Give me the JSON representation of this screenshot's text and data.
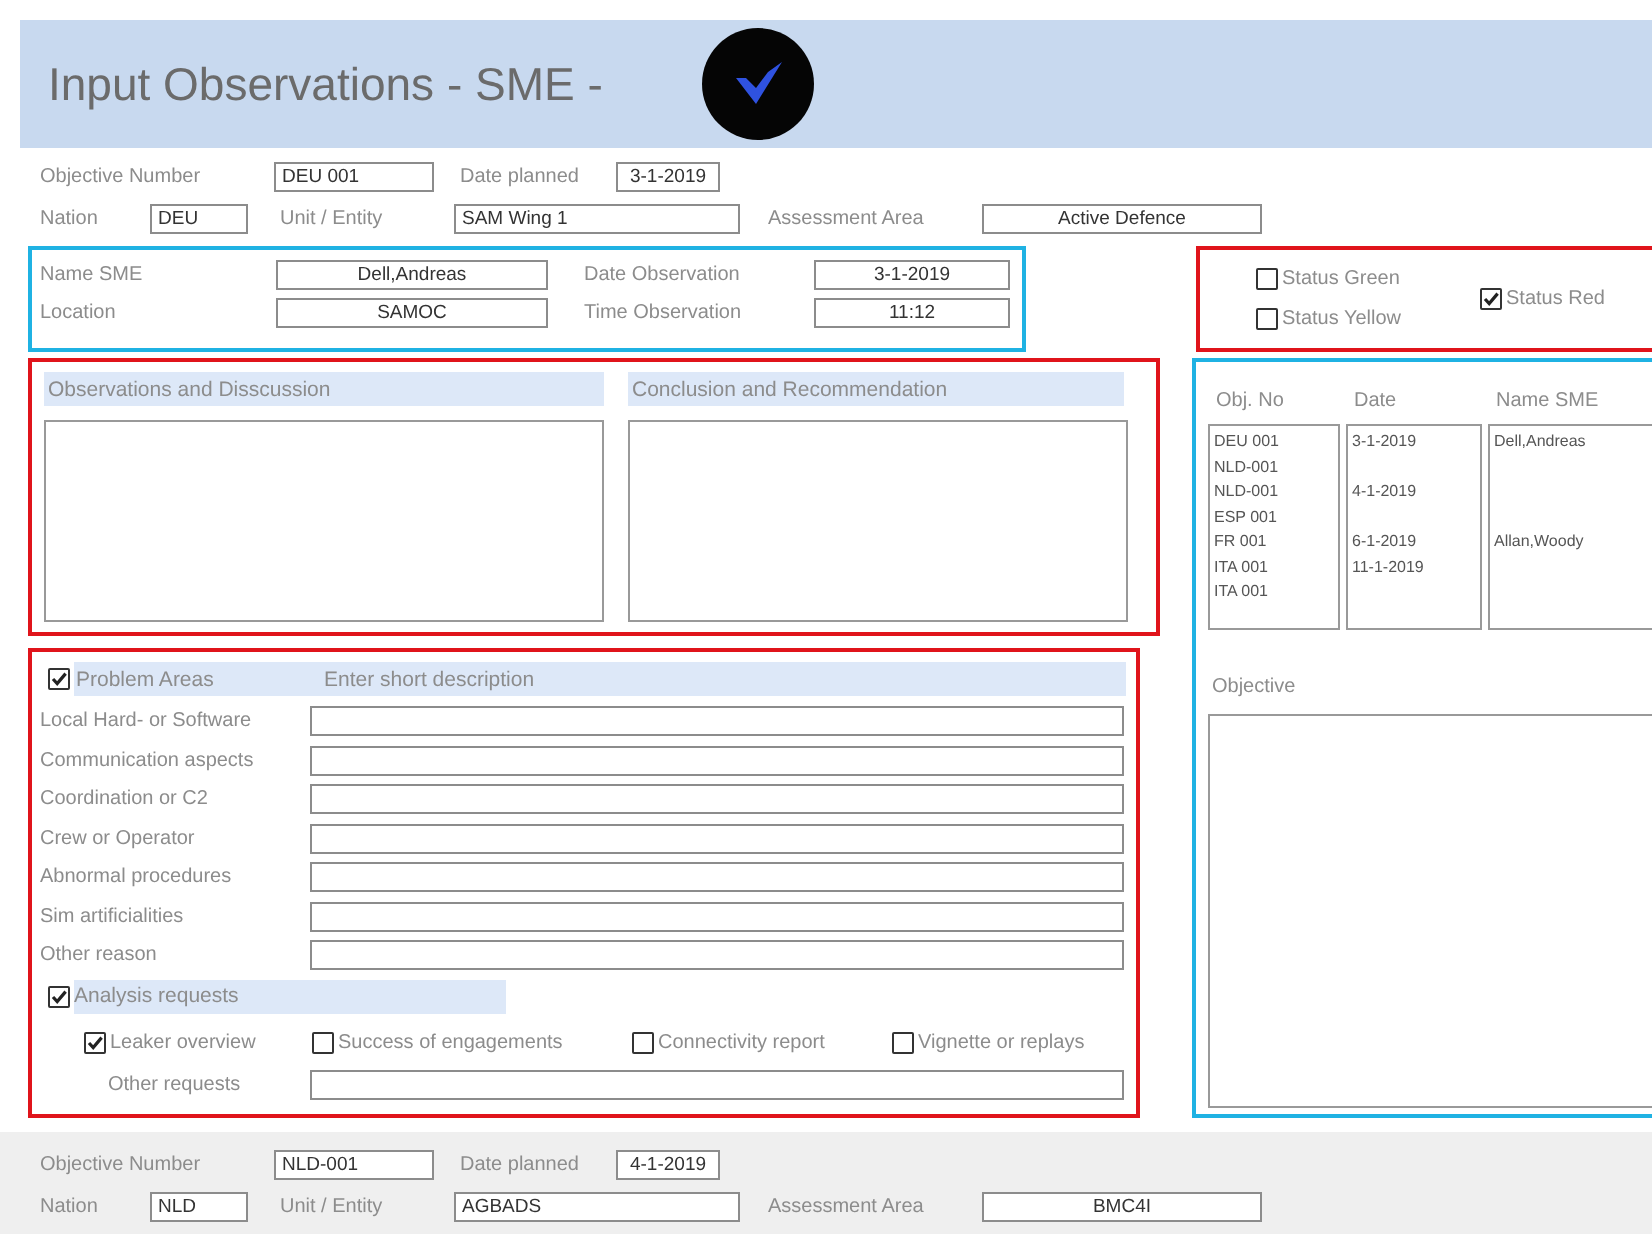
{
  "window": {
    "title": "Input Observations - SME -"
  },
  "records": [
    {
      "active": true,
      "rows": [
        [
          {
            "label": "Objective Number",
            "value": "DEU 001"
          },
          {
            "label": "Date planned",
            "value": "3-1-2019"
          }
        ],
        [
          {
            "label": "Nation",
            "value": "DEU"
          },
          {
            "label": "Unit / Entity",
            "value": "SAM Wing 1"
          },
          {
            "label": "Assessment Area",
            "value": "Active Defence"
          }
        ]
      ]
    },
    {
      "active": false,
      "rows": [
        [
          {
            "label": "Objective Number",
            "value": "NLD-001"
          },
          {
            "label": "Date planned",
            "value": "4-1-2019"
          }
        ],
        [
          {
            "label": "Nation",
            "value": "NLD"
          },
          {
            "label": "Unit / Entity",
            "value": "AGBADS"
          },
          {
            "label": "Assessment Area",
            "value": "BMC4I"
          }
        ]
      ]
    }
  ],
  "sme": [
    {
      "label": "Name SME",
      "value": "Dell,Andreas"
    },
    {
      "label": "Date Observation",
      "value": "3-1-2019"
    },
    {
      "label": "Location",
      "value": "SAMOC"
    },
    {
      "label": "Time Observation",
      "value": "11:12"
    }
  ],
  "status": [
    {
      "label": "Status Green",
      "checked": false
    },
    {
      "label": "Status Yellow",
      "checked": false
    },
    {
      "label": "Status Red",
      "checked": true
    }
  ],
  "panels": [
    {
      "heading": "Observations and Disscussion"
    },
    {
      "heading": "Conclusion and Recommendation"
    }
  ],
  "problems": {
    "label": "Problem Areas",
    "checked": true,
    "column_2": "Enter short description",
    "items": [
      "Local Hard- or Software",
      "Communication aspects",
      "Coordination or C2",
      "Crew or Operator",
      "Abnormal procedures",
      "Sim artificialities",
      "Other reason"
    ]
  },
  "analysis": {
    "label": "Analysis requests",
    "checked": true,
    "options": [
      {
        "label": "Leaker overview",
        "checked": true
      },
      {
        "label": "Success of engagements",
        "checked": false
      },
      {
        "label": "Connectivity report",
        "checked": false
      },
      {
        "label": "Vignette or replays",
        "checked": false
      }
    ],
    "other_label": "Other requests"
  },
  "list": {
    "columns": [
      "Obj. No",
      "Date",
      "Name SME"
    ],
    "rows": [
      {
        "obj_no": "DEU 001",
        "date": "3-1-2019",
        "name": "Dell,Andreas"
      },
      {
        "obj_no": "NLD-001"
      },
      {
        "obj_no": "NLD-001",
        "date": "4-1-2019"
      },
      {
        "obj_no": "ESP 001"
      },
      {
        "obj_no": "FR 001",
        "date": "6-1-2019",
        "name": "Allan,Woody"
      },
      {
        "obj_no": "ITA 001",
        "date": "11-1-2019"
      },
      {
        "obj_no": "ITA 001"
      }
    ]
  },
  "objective": {
    "label": "Objective"
  }
}
